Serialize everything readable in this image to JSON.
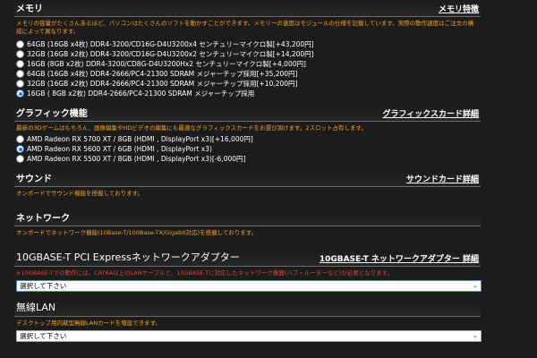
{
  "memory": {
    "title": "メモリ",
    "link": "メモリ特徴",
    "description": "メモリの容量がたくさんあるほど、パソコンはたくさんのソフトを動かすことができます。メモリーの速度はモジュールの仕様を記載しています。実際の動作速度はご注文の構成によって異なります。",
    "options": [
      {
        "label": "64GB (16GB x4枚) DDR4-3200/CD16G-D4U3200x4 センチュリーマイクロ製[+43,200円]",
        "selected": false
      },
      {
        "label": "32GB (16GB x2枚) DDR4-3200/CD16G-D4U3200x2 センチュリーマイクロ製[+14,200円]",
        "selected": false
      },
      {
        "label": "16GB (8GB x2枚) DDR4-3200/CD8G-D4U3200Hx2 センチュリーマイクロ製[+4,000円]",
        "selected": false
      },
      {
        "label": "64GB (16GB x4枚) DDR4-2666/PC4-21300 SDRAM メジャーチップ採用[+35,200円]",
        "selected": false
      },
      {
        "label": "32GB (16GB x2枚) DDR4-2666/PC4-21300 SDRAM メジャーチップ採用[+10,200円]",
        "selected": false
      },
      {
        "label": "16GB ( 8GB x2枚) DDR4-2666/PC4-21300 SDRAM メジャーチップ採用",
        "selected": true
      }
    ]
  },
  "graphics": {
    "title": "グラフィック機能",
    "link": "グラフィックスカード詳細",
    "description": "最新の3Dゲームはもちろん、画像編集やHDビデオの編集にも最適なグラフィックスカードをお選び頂けます。2スロット占有します。",
    "options": [
      {
        "label": "AMD Radeon RX 5700 XT / 8GB (HDMI , DisplayPort x3)[+16,000円]",
        "selected": false
      },
      {
        "label": "AMD Radeon RX 5600 XT / 6GB (HDMI , DisplayPort x3)",
        "selected": true
      },
      {
        "label": "AMD Radeon RX 5500 XT / 8GB (HDMI , DisplayPort x3)[-6,000円]",
        "selected": false
      }
    ]
  },
  "sound": {
    "title": "サウンド",
    "link": "サウンドカード詳細",
    "description": "オンボードでサウンド機能を搭載しております。"
  },
  "network": {
    "title": "ネットワーク",
    "description": "オンボードでネットワーク機能(10Base-T/100Base-TX/Gigabit対応)を搭載しております。"
  },
  "tengbe": {
    "title": "10GBASE-T PCI Expressネットワークアダプター",
    "link": "10GBASE-T ネットワークアダプター 詳細",
    "description": "※10GBASE-Tでの動作には、CAT6A以上のLANケーブルと、10GBASE-Tに対応したネットワーク機器(ハブ・ルーターなど)が必要となります。",
    "select_value": "選択して下さい"
  },
  "wireless": {
    "title": "無線LAN",
    "description": "デスクトップ用内蔵型無線LANカードを増設できます。",
    "select_value": "選択して下さい"
  }
}
